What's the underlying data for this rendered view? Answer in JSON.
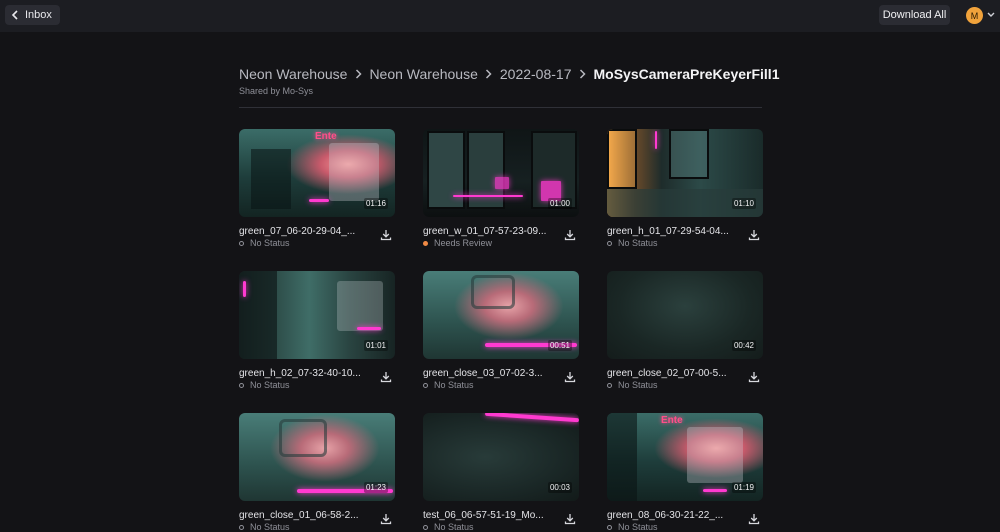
{
  "topbar": {
    "inbox_label": "Inbox",
    "download_all_label": "Download All",
    "avatar_initial": "M",
    "avatar_color": "#f0a23b"
  },
  "breadcrumb": {
    "items": [
      "Neon Warehouse",
      "Neon Warehouse",
      "2022-08-17"
    ],
    "current": "MoSysCameraPreKeyerFill1",
    "shared_by": "Shared by Mo-Sys"
  },
  "cards": [
    {
      "name": "green_07_06-20-29-04_...",
      "duration": "01:16",
      "status": "No Status",
      "thumb_icon": "rv-neon-scene"
    },
    {
      "name": "green_w_01_07-57-23-09...",
      "duration": "01:00",
      "status": "Needs Review",
      "thumb_icon": "warehouse-window-scene"
    },
    {
      "name": "green_h_01_07-29-54-04...",
      "duration": "01:10",
      "status": "No Status",
      "thumb_icon": "lit-window-scene"
    },
    {
      "name": "green_h_02_07-32-40-10...",
      "duration": "01:01",
      "status": "No Status",
      "thumb_icon": "hallway-scene"
    },
    {
      "name": "green_close_03_07-02-3...",
      "duration": "00:51",
      "status": "No Status",
      "thumb_icon": "closeup-scene"
    },
    {
      "name": "green_close_02_07-00-5...",
      "duration": "00:42",
      "status": "No Status",
      "thumb_icon": "dark-scene"
    },
    {
      "name": "green_close_01_06-58-2...",
      "duration": "01:23",
      "status": "No Status",
      "thumb_icon": "closeup-scene"
    },
    {
      "name": "test_06_06-57-51-19_Mo...",
      "duration": "00:03",
      "status": "No Status",
      "thumb_icon": "dark-neon-scene"
    },
    {
      "name": "green_08_06-30-21-22_...",
      "duration": "01:19",
      "status": "No Status",
      "thumb_icon": "rv-neon-scene"
    }
  ],
  "colors": {
    "background": "#131316",
    "topbar": "#1c1d22",
    "neon": "#ff3ad0",
    "review_dot": "#f08a45"
  }
}
